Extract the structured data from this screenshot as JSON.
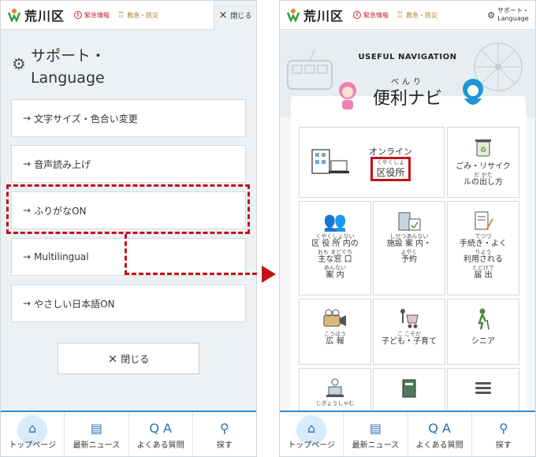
{
  "header": {
    "logo_text": "荒川区",
    "emergency": "緊急情報",
    "rescue": "救急・防災",
    "close": "閉じる",
    "support_line1": "サポート・",
    "support_line2": "Language"
  },
  "left": {
    "title_line1": "サポート・",
    "title_line2": "Language",
    "items": [
      {
        "label": "文字サイズ・色合い変更"
      },
      {
        "label": "音声読み上げ"
      },
      {
        "label": "ふりがなON"
      },
      {
        "label": "Multilingual"
      },
      {
        "label": "やさしい日本語ON"
      }
    ],
    "close_button": "閉じる"
  },
  "right": {
    "useful_nav": "USEFUL NAVIGATION",
    "benri_ruby": "べんり",
    "benri_title": "便利ナビ",
    "tiles": [
      {
        "line1": "オンライン",
        "ruby": "くやくしょ",
        "line2": "区役所"
      },
      {
        "line1": "ごみ・リサイク",
        "ruby": "だ かた",
        "line2": "ルの出し方"
      },
      {
        "ruby1": "くやくしょない",
        "line1": "区 役 所 内の",
        "ruby2": "おも まどぐち",
        "line2": "主な窓 口",
        "ruby3": "あんない",
        "line3": "案 内"
      },
      {
        "ruby1": "しせつあんない",
        "line1": "施設 案 内・",
        "ruby2": "よやく",
        "line2": "予約"
      },
      {
        "ruby1": "てつづ",
        "line1": "手続き・よく",
        "ruby2": "りよう",
        "line2": "利用される",
        "ruby3": "とどけで",
        "line3": "届 出"
      },
      {
        "ruby1": "こうほう",
        "line1": "広 報"
      },
      {
        "ruby1": "こ こそだ",
        "line1": "子ども・子育て"
      },
      {
        "line1": "シニア"
      },
      {
        "ruby1": "じぎょうしゃむ",
        "line1": ""
      },
      {
        "line1": ""
      },
      {
        "line1": ""
      }
    ]
  },
  "bottom_nav": [
    {
      "label": "トップページ",
      "icon": "home-icon"
    },
    {
      "label": "最新ニュース",
      "icon": "news-icon"
    },
    {
      "label": "よくある質問",
      "icon": "faq-icon"
    },
    {
      "label": "探す",
      "icon": "search-icon"
    }
  ],
  "colors": {
    "accent_red": "#c0141c",
    "accent_blue": "#2c8bd4",
    "logo_green": "#2e9b3f"
  }
}
